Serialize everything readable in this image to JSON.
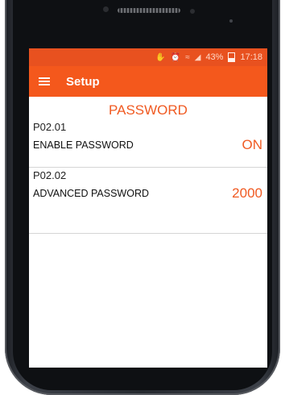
{
  "status_bar": {
    "icons": [
      "mute-icon",
      "alarm-icon",
      "wifi-icon",
      "signal-icon"
    ],
    "battery": "43%",
    "time": "17:18"
  },
  "app_bar": {
    "title": "Setup",
    "menu_icon": "hamburger-menu-icon",
    "color": "#f4581c"
  },
  "section": {
    "title": "PASSWORD"
  },
  "parameters": [
    {
      "code": "P02.01",
      "label": "ENABLE PASSWORD",
      "value": "ON"
    },
    {
      "code": "P02.02",
      "label": "ADVANCED PASSWORD",
      "value": "2000"
    }
  ],
  "colors": {
    "accent": "#f05a22",
    "statusbar": "#e8511f"
  }
}
